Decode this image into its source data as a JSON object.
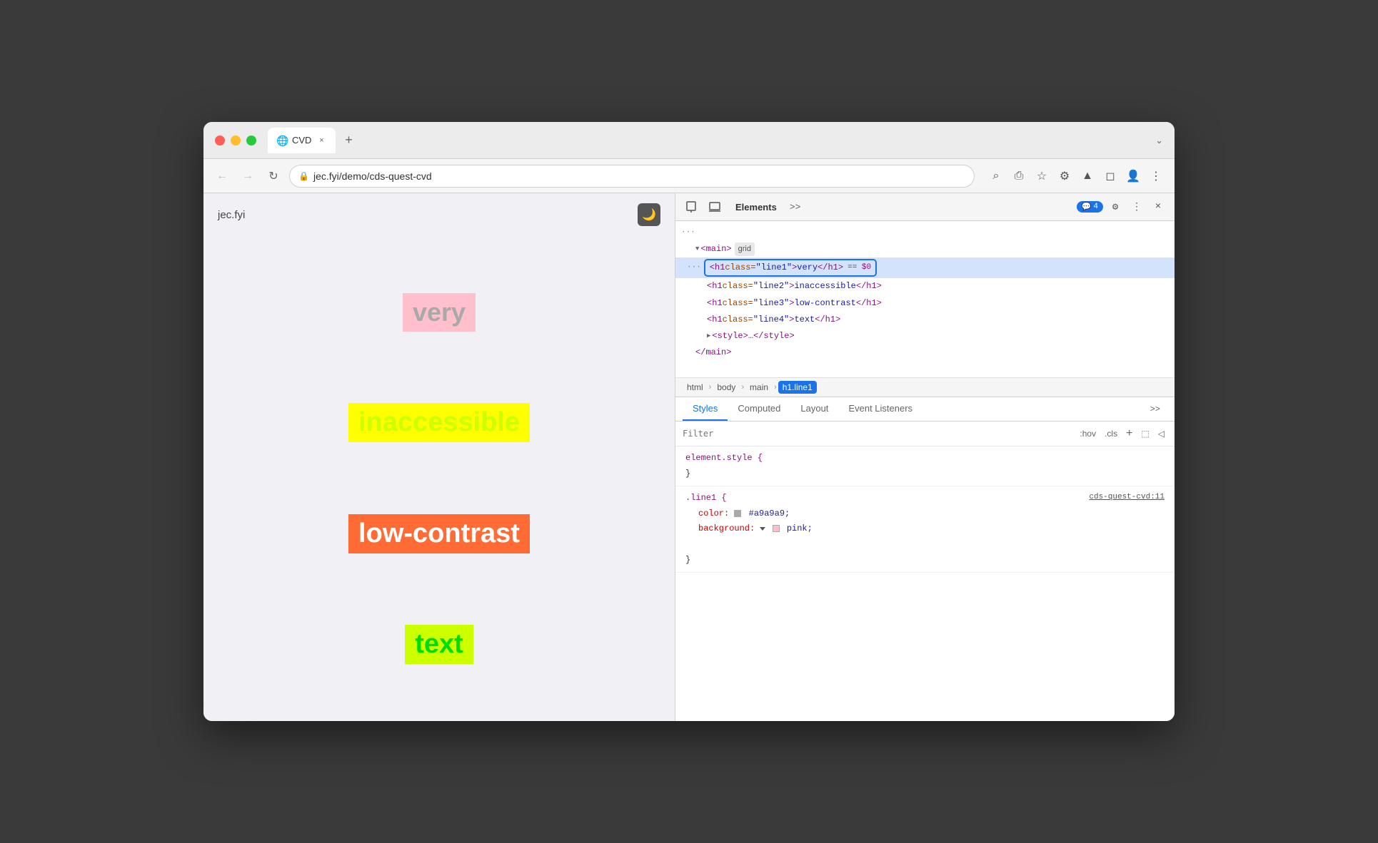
{
  "window": {
    "title": "CVD"
  },
  "titlebar": {
    "traffic": {
      "close": "close",
      "minimize": "minimize",
      "maximize": "maximize"
    },
    "tab": {
      "favicon": "🌐",
      "label": "CVD",
      "close": "×"
    },
    "new_tab": "+",
    "expand": "⌄"
  },
  "addressbar": {
    "back": "←",
    "forward": "→",
    "reload": "↻",
    "url": "jec.fyi/demo/cds-quest-cvd",
    "lock_icon": "🔒",
    "search_icon": "⌕",
    "share_icon": "⎙",
    "star_icon": "☆",
    "ext_icon1": "⚙",
    "ext_icon2": "▲",
    "ext_icon3": "◻",
    "profile_icon": "👤",
    "menu_icon": "⋮"
  },
  "webpage": {
    "site_name": "jec.fyi",
    "moon_icon": "🌙",
    "lines": [
      {
        "text": "very",
        "class": "line1"
      },
      {
        "text": "inaccessible",
        "class": "line2"
      },
      {
        "text": "low-contrast",
        "class": "line3"
      },
      {
        "text": "text",
        "class": "line4"
      }
    ]
  },
  "devtools": {
    "toolbar": {
      "cursor_icon": "⬚",
      "layers_icon": "◱",
      "panels": [
        "Elements",
        ">>"
      ],
      "badge_icon": "💬",
      "badge_count": "4",
      "settings_icon": "⚙",
      "more_icon": "⋮",
      "close_icon": "×"
    },
    "dom": {
      "parent_tag": "<main>",
      "parent_class": "grid",
      "selected_line": "<h1 class=\"line1\">very</h1> == $0",
      "line2": "<h1 class=\"line2\">inaccessible</h1>",
      "line3": "<h1 class=\"line3\">low-contrast</h1>",
      "line4": "<h1 class=\"line4\">text</h1>",
      "style_tag": "<style>…</style>",
      "close_main": "</main>",
      "dots": "···"
    },
    "breadcrumb": {
      "items": [
        "html",
        "body",
        "main",
        "h1.line1"
      ]
    },
    "subtabs": {
      "tabs": [
        "Styles",
        "Computed",
        "Layout",
        "Event Listeners",
        ">>"
      ]
    },
    "filter": {
      "placeholder": "Filter",
      "hov_label": ":hov",
      "cls_label": ".cls",
      "add_label": "+",
      "new_style_icon": "⬚",
      "toggle_icon": "◁"
    },
    "styles": {
      "rule1": {
        "selector": "element.style {",
        "close": "}"
      },
      "rule2": {
        "selector": ".line1 {",
        "link": "cds-quest-cvd:11",
        "props": [
          {
            "name": "color:",
            "value": "#a9a9a9",
            "swatch_color": "#a9a9a9"
          },
          {
            "name": "background:",
            "value": "pink",
            "swatch_color": "#ffc0cb"
          }
        ],
        "close": "}"
      }
    }
  }
}
